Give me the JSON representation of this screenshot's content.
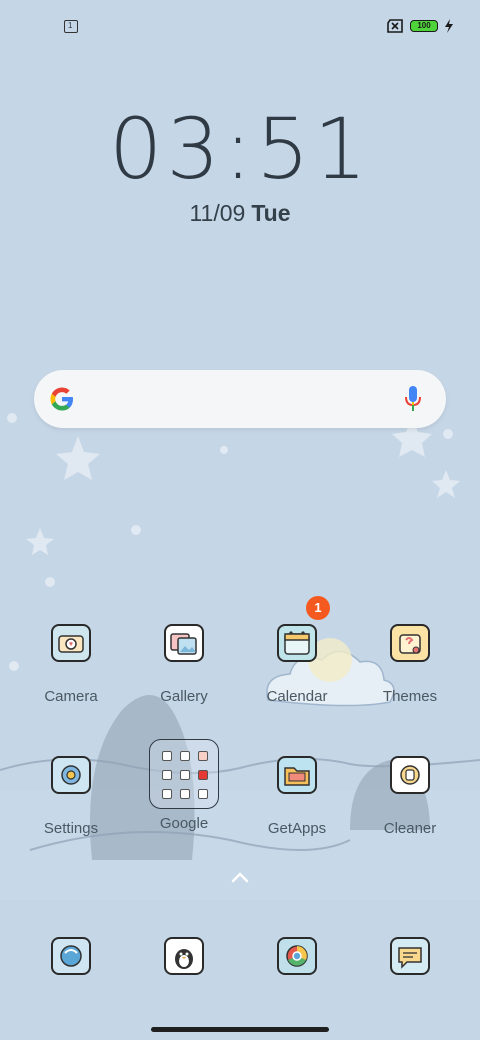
{
  "status_bar": {
    "notification_icon_label": "1",
    "battery_level": "100",
    "icons": [
      "calendar-notification-icon",
      "no-sim-icon",
      "battery-icon",
      "charging-bolt-icon"
    ]
  },
  "clock": {
    "time": "03:51",
    "date": "11/09",
    "day": "Tue"
  },
  "search": {
    "icons": [
      "google-logo-icon",
      "microphone-icon"
    ]
  },
  "apps_row1": [
    {
      "label": "Camera"
    },
    {
      "label": "Gallery"
    },
    {
      "label": "Calendar",
      "badge": "1"
    },
    {
      "label": "Themes"
    }
  ],
  "apps_row2": [
    {
      "label": "Settings"
    },
    {
      "label": "Google"
    },
    {
      "label": "GetApps"
    },
    {
      "label": "Cleaner"
    }
  ],
  "dock": [
    "phone-app-icon",
    "messaging-penguin-icon",
    "chrome-browser-icon",
    "messages-chat-icon"
  ],
  "colors": {
    "background": "#c5d6e7",
    "badge": "#f45a1f",
    "battery": "#4fd33a"
  }
}
